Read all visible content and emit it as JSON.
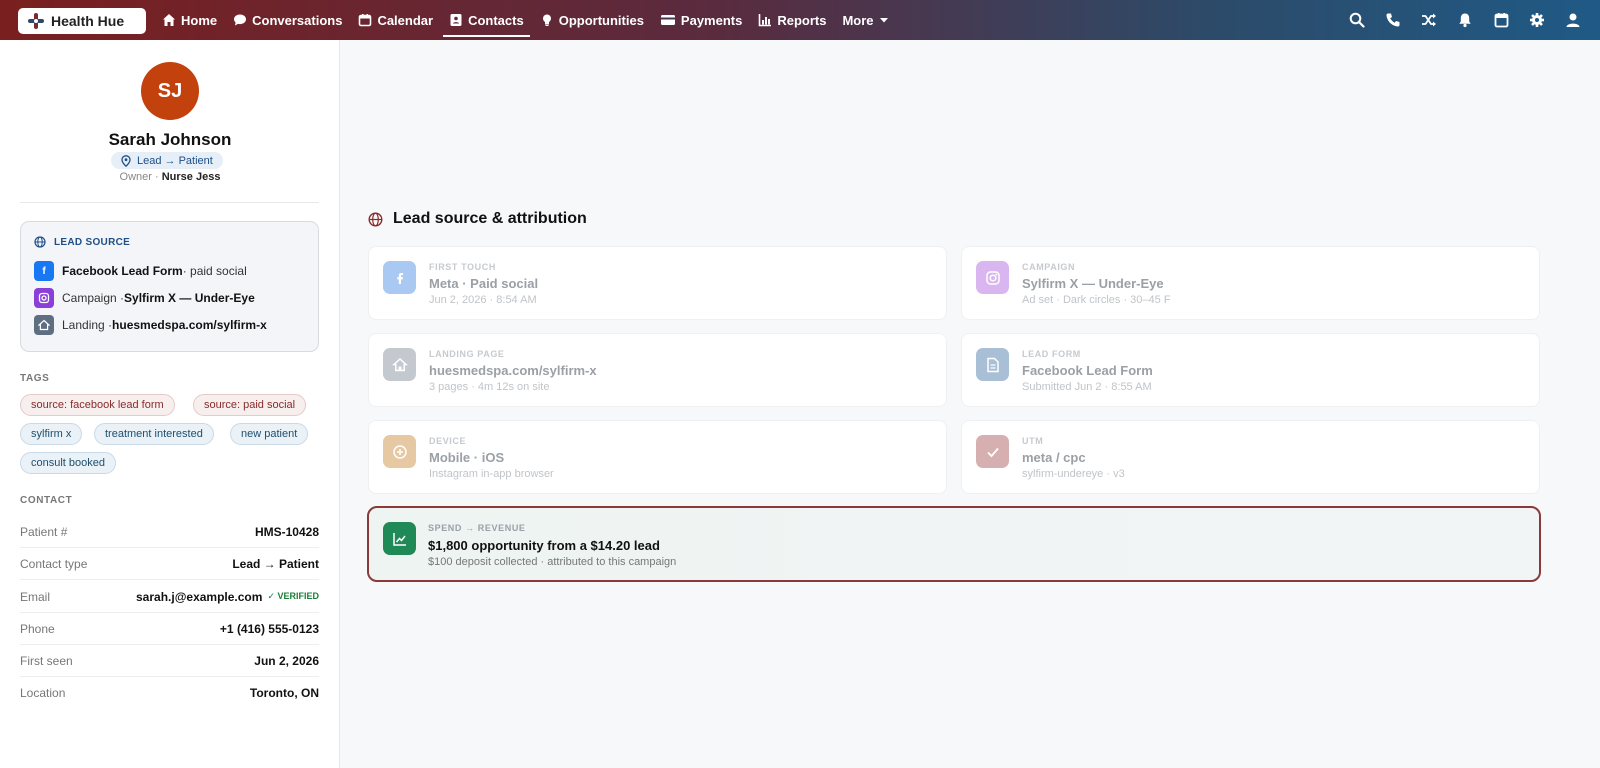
{
  "brand": {
    "name": "Health Hue"
  },
  "nav": {
    "items": [
      {
        "label": "Home",
        "icon": "home-icon"
      },
      {
        "label": "Conversations",
        "icon": "chat-icon"
      },
      {
        "label": "Calendar",
        "icon": "calendar-icon"
      },
      {
        "label": "Contacts",
        "icon": "contacts-icon",
        "active": true
      },
      {
        "label": "Opportunities",
        "icon": "lightbulb-icon"
      },
      {
        "label": "Payments",
        "icon": "card-icon"
      },
      {
        "label": "Reports",
        "icon": "chart-icon"
      },
      {
        "label": "More",
        "icon": "caret-down-icon"
      }
    ],
    "right_icons": [
      "search-icon",
      "phone-icon",
      "shuffle-icon",
      "bell-icon",
      "calendar-icon",
      "gear-icon",
      "user-icon"
    ]
  },
  "contact": {
    "initials": "SJ",
    "name": "Sarah Johnson",
    "stage": "Lead → Patient",
    "owner_label": "Owner",
    "owner": "Nurse Jess",
    "avatar_color": "#c2410c"
  },
  "lead_source": {
    "title": "LEAD SOURCE",
    "rows": [
      {
        "icon": "facebook-icon",
        "strong": "Facebook Lead Form",
        "rest": " · paid social"
      },
      {
        "icon": "instagram-icon",
        "prefix": "Campaign · ",
        "strong": "Sylfirm X — Under-Eye"
      },
      {
        "icon": "home-icon",
        "prefix": "Landing · ",
        "strong": "huesmedspa.com/sylfirm-x"
      }
    ]
  },
  "tags": {
    "title": "TAGS",
    "items": [
      "source: facebook lead form",
      "source: paid social",
      "sylfirm x",
      "treatment interested",
      "new patient",
      "consult booked"
    ]
  },
  "contact_info": {
    "title": "CONTACT",
    "rows": [
      {
        "key": "Patient #",
        "value": "HMS-10428"
      },
      {
        "key": "Contact type",
        "value": "Lead → Patient"
      },
      {
        "key": "Email",
        "value": "sarah.j@example.com",
        "badge": "✓ VERIFIED"
      },
      {
        "key": "Phone",
        "value": "+1 (416) 555-0123"
      },
      {
        "key": "First seen",
        "value": "Jun 2, 2026"
      },
      {
        "key": "Location",
        "value": "Toronto, ON"
      }
    ]
  },
  "attribution": {
    "title": "Lead source & attribution",
    "cards": [
      {
        "label": "FIRST TOUCH",
        "value": "Meta · Paid social",
        "sub": "Jun 2, 2026 · 8:54 AM",
        "icon": "facebook-icon",
        "color": "#a9c8f2"
      },
      {
        "label": "CAMPAIGN",
        "value": "Sylfirm X — Under-Eye",
        "sub": "Ad set · Dark circles · 30–45 F",
        "icon": "instagram-icon",
        "color": "#d9b6f0"
      },
      {
        "label": "LANDING PAGE",
        "value": "huesmedspa.com/sylfirm-x",
        "sub": "3 pages · 4m 12s on site",
        "icon": "home-icon",
        "color": "#c4c9d0"
      },
      {
        "label": "LEAD FORM",
        "value": "Facebook Lead Form",
        "sub": "Submitted Jun 2 · 8:55 AM",
        "icon": "document-icon",
        "color": "#a8bfd6"
      },
      {
        "label": "DEVICE",
        "value": "Mobile · iOS",
        "sub": "Instagram in-app browser",
        "icon": "plus-circle-icon",
        "color": "#e6c9a2"
      },
      {
        "label": "UTM",
        "value": "meta / cpc",
        "sub": "sylfirm-undereye · v3",
        "icon": "check-icon",
        "color": "#d6b0b0"
      }
    ],
    "spend": {
      "label": "SPEND → REVENUE",
      "value": "$1,800 opportunity from a $14.20 lead",
      "sub": "$100 deposit collected · attributed to this campaign",
      "icon": "line-chart-icon",
      "color": "#1f8a57"
    }
  }
}
